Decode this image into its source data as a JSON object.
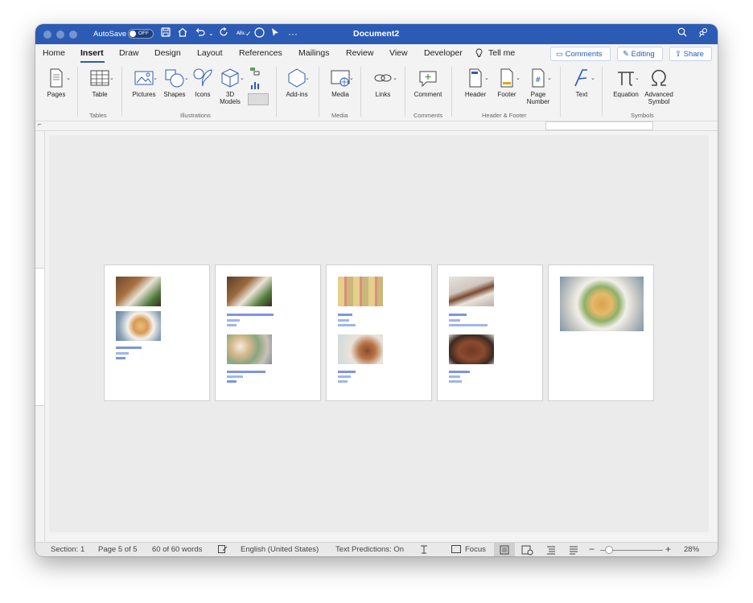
{
  "titlebar": {
    "autosave_label": "AutoSave",
    "autosave_state": "OFF",
    "document_title": "Document2"
  },
  "tabs": [
    "Home",
    "Insert",
    "Draw",
    "Design",
    "Layout",
    "References",
    "Mailings",
    "Review",
    "View",
    "Developer",
    "Tell me"
  ],
  "active_tab": "Insert",
  "header_buttons": {
    "comments": "Comments",
    "editing": "Editing",
    "share": "Share"
  },
  "ribbon": {
    "pages": "Pages",
    "table": "Table",
    "pictures": "Pictures",
    "shapes": "Shapes",
    "icons": "Icons",
    "models_3d": "3D Models",
    "addins": "Add-ins",
    "media": "Media",
    "links": "Links",
    "comment": "Comment",
    "header": "Header",
    "footer": "Footer",
    "page_number": "Page Number",
    "text": "Text",
    "equation": "Equation",
    "advanced_symbol": "Advanced Symbol",
    "groups": {
      "tables": "Tables",
      "illustrations": "Illustrations",
      "media": "Media",
      "comments": "Comments",
      "header_footer": "Header & Footer",
      "symbols": "Symbols"
    }
  },
  "status": {
    "section": "Section: 1",
    "page": "Page 5 of 5",
    "words": "60 of 60 words",
    "language": "English (United States)",
    "predictions": "Text Predictions: On",
    "focus": "Focus",
    "zoom": "28%"
  },
  "colors": {
    "accent": "#2b5bb5",
    "selection": "#9eb6ea"
  }
}
